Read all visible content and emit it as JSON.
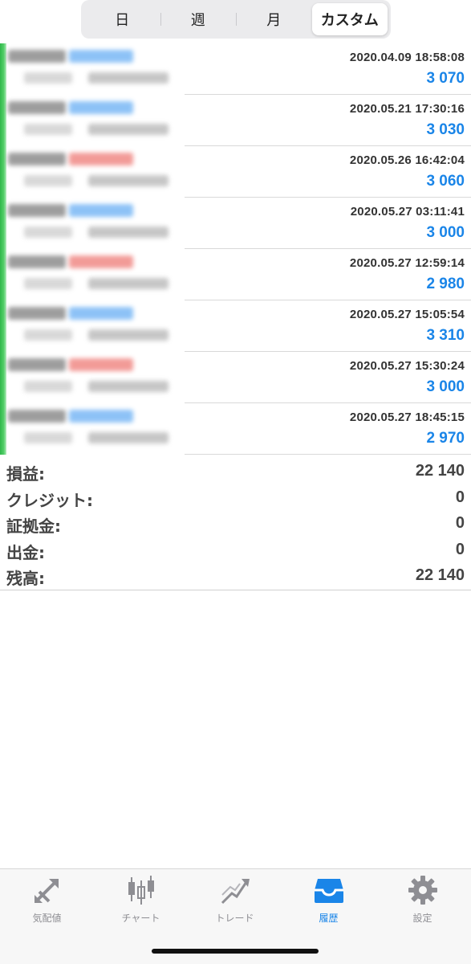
{
  "segments": [
    {
      "label": "日",
      "active": false
    },
    {
      "label": "週",
      "active": false
    },
    {
      "label": "月",
      "active": false
    },
    {
      "label": "カスタム",
      "active": true
    }
  ],
  "rows": [
    {
      "time": "2020.04.09 18:58:08",
      "amount": "3 070",
      "tag_color": "#7ab8f5"
    },
    {
      "time": "2020.05.21 17:30:16",
      "amount": "3 030",
      "tag_color": "#7ab8f5"
    },
    {
      "time": "2020.05.26 16:42:04",
      "amount": "3 060",
      "tag_color": "#f08a86"
    },
    {
      "time": "2020.05.27 03:11:41",
      "amount": "3 000",
      "tag_color": "#7ab8f5"
    },
    {
      "time": "2020.05.27 12:59:14",
      "amount": "2 980",
      "tag_color": "#f08a86"
    },
    {
      "time": "2020.05.27 15:05:54",
      "amount": "3 310",
      "tag_color": "#7ab8f5"
    },
    {
      "time": "2020.05.27 15:30:24",
      "amount": "3 000",
      "tag_color": "#f08a86"
    },
    {
      "time": "2020.05.27 18:45:15",
      "amount": "2 970",
      "tag_color": "#7ab8f5"
    }
  ],
  "summary": [
    {
      "label": "損益:",
      "value": "22 140"
    },
    {
      "label": "クレジット:",
      "value": "0"
    },
    {
      "label": "証拠金:",
      "value": "0"
    },
    {
      "label": "出金:",
      "value": "0"
    },
    {
      "label": "残高:",
      "value": "22 140"
    }
  ],
  "tabs": [
    {
      "label": "気配値",
      "icon": "quotes-icon",
      "active": false
    },
    {
      "label": "チャート",
      "icon": "candlestick-icon",
      "active": false
    },
    {
      "label": "トレード",
      "icon": "trade-icon",
      "active": false
    },
    {
      "label": "履歴",
      "icon": "history-inbox-icon",
      "active": true
    },
    {
      "label": "設定",
      "icon": "gear-icon",
      "active": false
    }
  ],
  "colors": {
    "accent": "#1a85e8",
    "profit_bar": "#2fb84a",
    "text": "#333333",
    "inactive_tab": "#8e8e93"
  }
}
